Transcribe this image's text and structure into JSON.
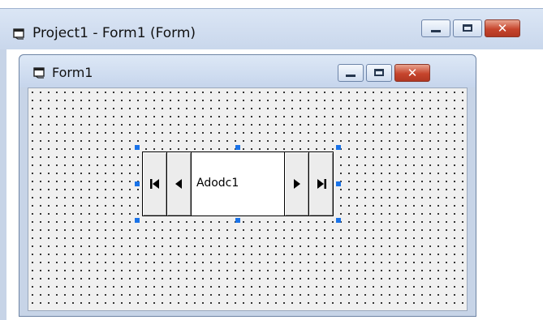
{
  "outer_window": {
    "title": "Project1 - Form1 (Form)",
    "icon": "form-icon",
    "buttons": [
      "minimize-icon",
      "maximize-icon",
      "close-icon"
    ]
  },
  "form_window": {
    "title": "Form1",
    "icon": "form-icon",
    "buttons": [
      "minimize-icon",
      "maximize-icon",
      "close-icon"
    ]
  },
  "adodc": {
    "caption": "Adodc1",
    "buttons": [
      "move-first-icon",
      "move-previous-icon",
      "move-next-icon",
      "move-last-icon"
    ]
  },
  "colors": {
    "titlebar": "#c9d7ec",
    "form_background": "#f0f0f0",
    "selection_handle": "#1a73e8",
    "close_button": "#c6452d"
  }
}
